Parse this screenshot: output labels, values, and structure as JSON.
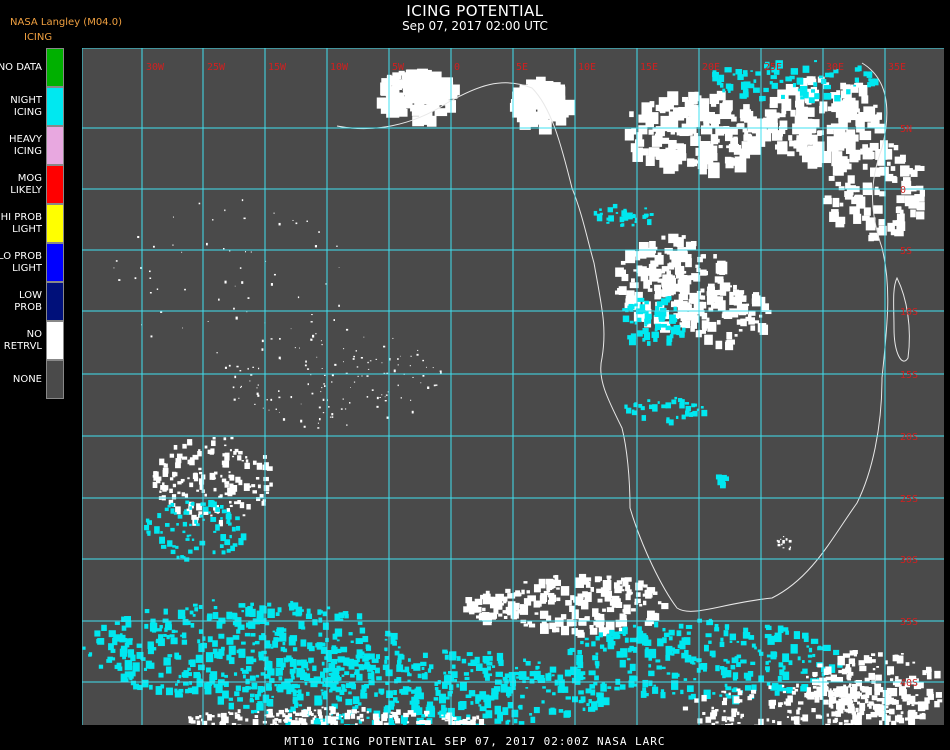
{
  "header": {
    "title": "ICING POTENTIAL",
    "subtitle": "Sep 07, 2017 02:00 UTC",
    "producer": "NASA Langley (M04.0)",
    "product": "ICING"
  },
  "legend": [
    {
      "label": "NO DATA",
      "color": "#00b000"
    },
    {
      "label": "NIGHT\nICING",
      "color": "#00e8f0"
    },
    {
      "label": "HEAVY\nICING",
      "color": "#e8a8e0"
    },
    {
      "label": "MOG\nLIKELY",
      "color": "#ff0000"
    },
    {
      "label": "HI PROB\nLIGHT",
      "color": "#ffff00"
    },
    {
      "label": "LO PROB\nLIGHT",
      "color": "#0000ff"
    },
    {
      "label": "LOW\nPROB",
      "color": "#00107a"
    },
    {
      "label": "NO\nRETRVL",
      "color": "#ffffff"
    },
    {
      "label": "NONE",
      "color": "#4a4a4a"
    }
  ],
  "map": {
    "grid_color": "#40e0f0",
    "label_color": "#d02020",
    "land_outline_color": "#e8e8e8",
    "lon_labels": [
      "30W",
      "25W",
      "15W",
      "10W",
      "5W",
      "0",
      "5E",
      "10E",
      "15E",
      "20E",
      "25E",
      "30E",
      "35E"
    ],
    "lat_labels": [
      "5N",
      "0",
      "5S",
      "10S",
      "15S",
      "20S",
      "25S",
      "30S",
      "35S",
      "40S"
    ]
  },
  "footer": {
    "text": "MT10  ICING POTENTIAL   SEP 07, 2017 02:00Z   NASA LARC"
  }
}
